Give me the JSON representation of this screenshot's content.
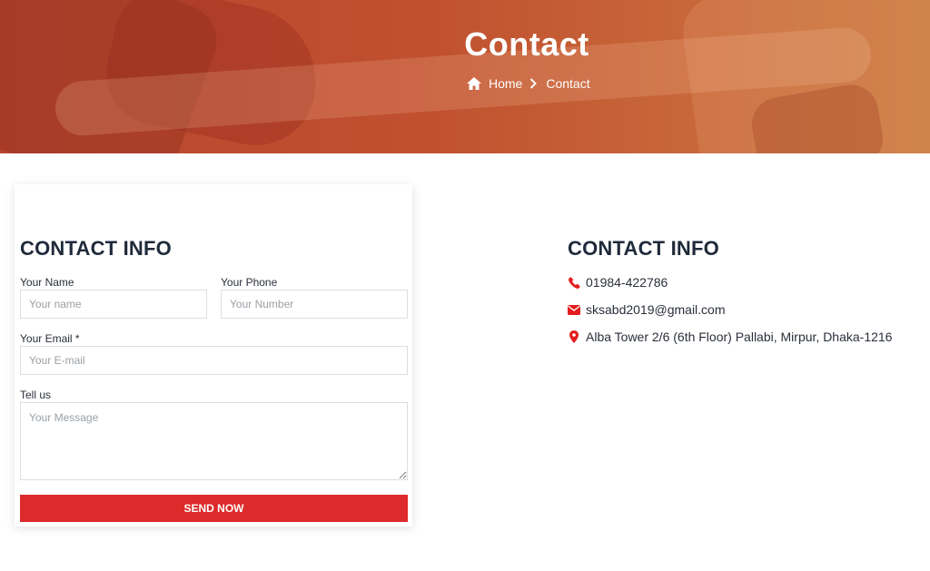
{
  "hero": {
    "title": "Contact",
    "breadcrumb": {
      "home": "Home",
      "current": "Contact"
    }
  },
  "form": {
    "title": "CONTACT INFO",
    "name": {
      "label": "Your Name",
      "placeholder": "Your name"
    },
    "phone": {
      "label": "Your Phone",
      "placeholder": "Your Number"
    },
    "email": {
      "label": "Your Email *",
      "placeholder": "Your E-mail"
    },
    "message": {
      "label": "Tell us",
      "placeholder": "Your Message"
    },
    "submit_label": "SEND NOW"
  },
  "info": {
    "title": "CONTACT INFO",
    "phone": "01984-422786",
    "email": "sksabd2019@gmail.com",
    "address": "Alba Tower 2/6 (6th Floor) Pallabi, Mirpur, Dhaka-1216"
  },
  "colors": {
    "accent": "#dd2a2a",
    "icon": "#e41e1e",
    "heading": "#1f2a3a"
  },
  "icons": {
    "home": "home-icon",
    "chevron": "chevron-right-icon",
    "phone": "phone-icon",
    "email": "envelope-icon",
    "address": "map-marker-icon"
  }
}
